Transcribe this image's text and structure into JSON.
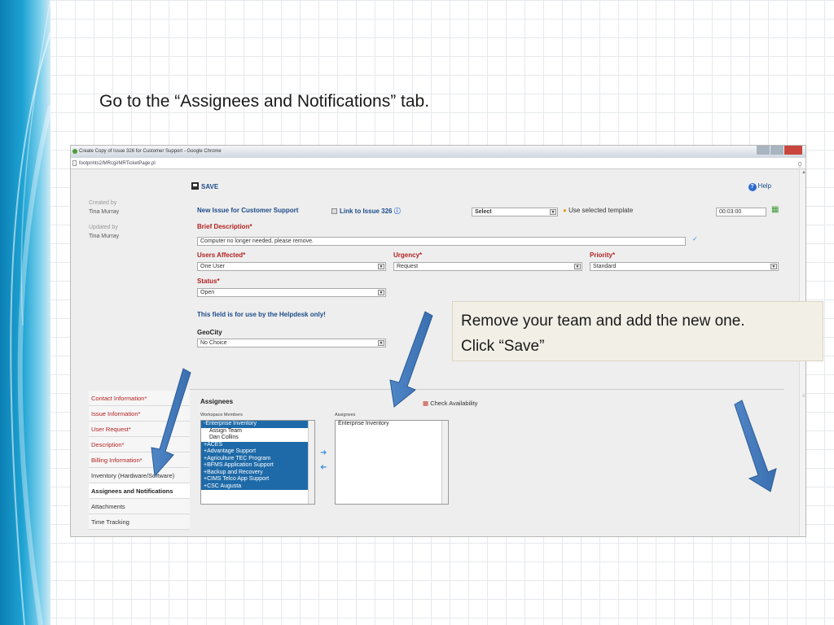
{
  "slide": {
    "heading": "Go to the “Assignees and Notifications” tab.",
    "callout_line1": "Remove your team and add the new one.",
    "callout_line2": "Click “Save”"
  },
  "browser": {
    "window_title": "Create Copy of Issue 326 for Customer Support - Google Chrome",
    "url": "footprints2/MRcgi/MRTicketPage.pl"
  },
  "toolbar": {
    "save_label": "SAVE",
    "help_label": "Help"
  },
  "meta": {
    "created_by_label": "Created by",
    "created_by_value": "Tina Murray",
    "updated_by_label": "Updated by",
    "updated_by_value": "Tina Murray"
  },
  "form": {
    "issue_title": "New Issue for Customer Support",
    "link_label": "Link to Issue 326",
    "template_select": "Select",
    "template_label": "Use selected template",
    "timer": "00:03:00",
    "brief_description_label": "Brief Description*",
    "brief_description_value": "Computer no longer needed, please remove.",
    "users_affected_label": "Users Affected*",
    "users_affected_value": "One User",
    "urgency_label": "Urgency*",
    "urgency_value": "Request",
    "priority_label": "Priority*",
    "priority_value": "Standard",
    "status_label": "Status*",
    "status_value": "Open",
    "helpdesk_note": "This field is for use by the Helpdesk only!",
    "geocity_label": "GeoCity",
    "geocity_value": "No Choice"
  },
  "sidebar": {
    "items": [
      {
        "label": "Contact Information*"
      },
      {
        "label": "Issue Information*"
      },
      {
        "label": "User Request*"
      },
      {
        "label": "Description*"
      },
      {
        "label": "Billing Information*"
      },
      {
        "label": "Inventory (Hardware/Software)"
      },
      {
        "label": "Assignees and Notifications"
      },
      {
        "label": "Attachments"
      },
      {
        "label": "Time Tracking"
      }
    ]
  },
  "assignees": {
    "section_title": "Assignees",
    "check_availability": "Check Availability",
    "workspace_members_label": "Workspace Members",
    "assignees_label": "Assignees",
    "members": [
      "-Enterprise Inventory",
      "Assign Team",
      "Dan Collins",
      "+ACES",
      "+Advantage Support",
      "+Agriculture TEC Program",
      "+BFMS Application Support",
      "+Backup and Recovery",
      "+CIMS Telco App Support",
      "+CSC Augusta"
    ],
    "assigned": [
      "Enterprise Inventory"
    ]
  }
}
